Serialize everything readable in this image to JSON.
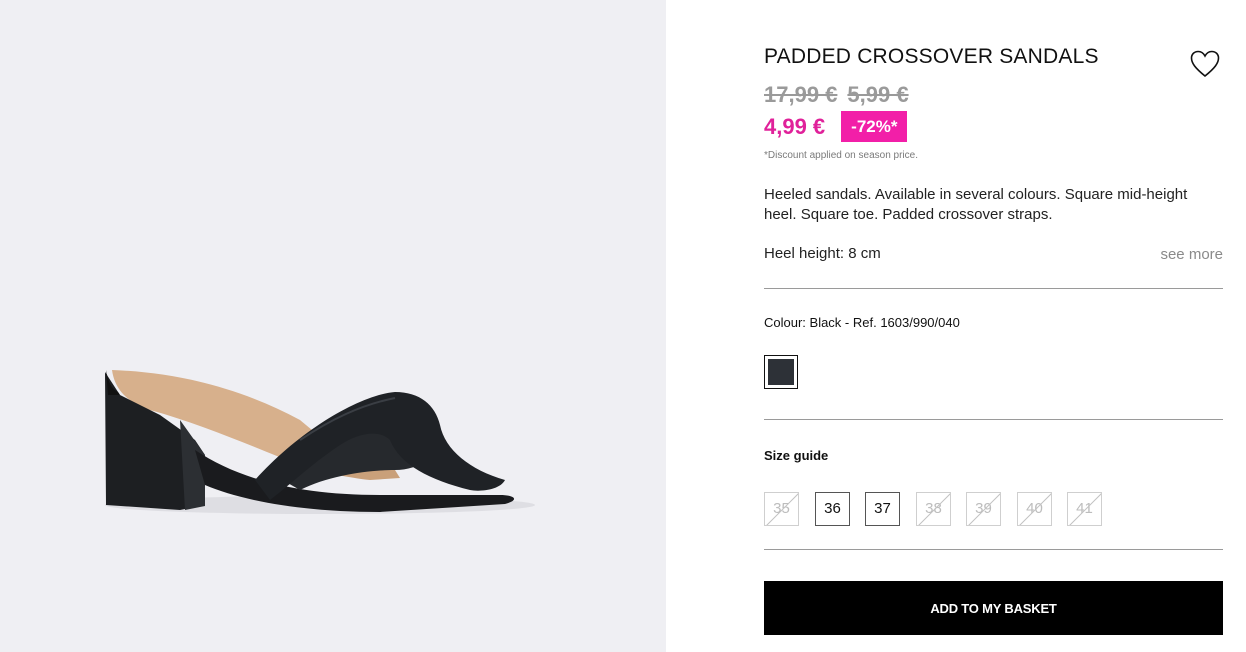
{
  "product": {
    "title": "PADDED CROSSOVER SANDALS",
    "old_prices": [
      "17,99 €",
      "5,99 €"
    ],
    "price": "4,99 €",
    "discount_badge": "-72%*",
    "discount_note": "*Discount applied on season price.",
    "description": "Heeled sandals. Available in several colours. Square mid-height heel. Square toe. Padded crossover straps.",
    "heel_height": "Heel height: 8 cm",
    "see_more": "see more",
    "colour_label": "Colour: Black - Ref. 1603/990/040",
    "swatch_color": "#2d3137",
    "accent_color": "#f21fa8",
    "price_color": "#e0219a"
  },
  "sizes": {
    "guide_label": "Size guide",
    "options": [
      {
        "label": "35",
        "available": false
      },
      {
        "label": "36",
        "available": true
      },
      {
        "label": "37",
        "available": true
      },
      {
        "label": "38",
        "available": false
      },
      {
        "label": "39",
        "available": false
      },
      {
        "label": "40",
        "available": false
      },
      {
        "label": "41",
        "available": false
      }
    ]
  },
  "actions": {
    "add_to_basket": "ADD TO MY BASKET",
    "wishlist_icon": "heart-icon"
  }
}
